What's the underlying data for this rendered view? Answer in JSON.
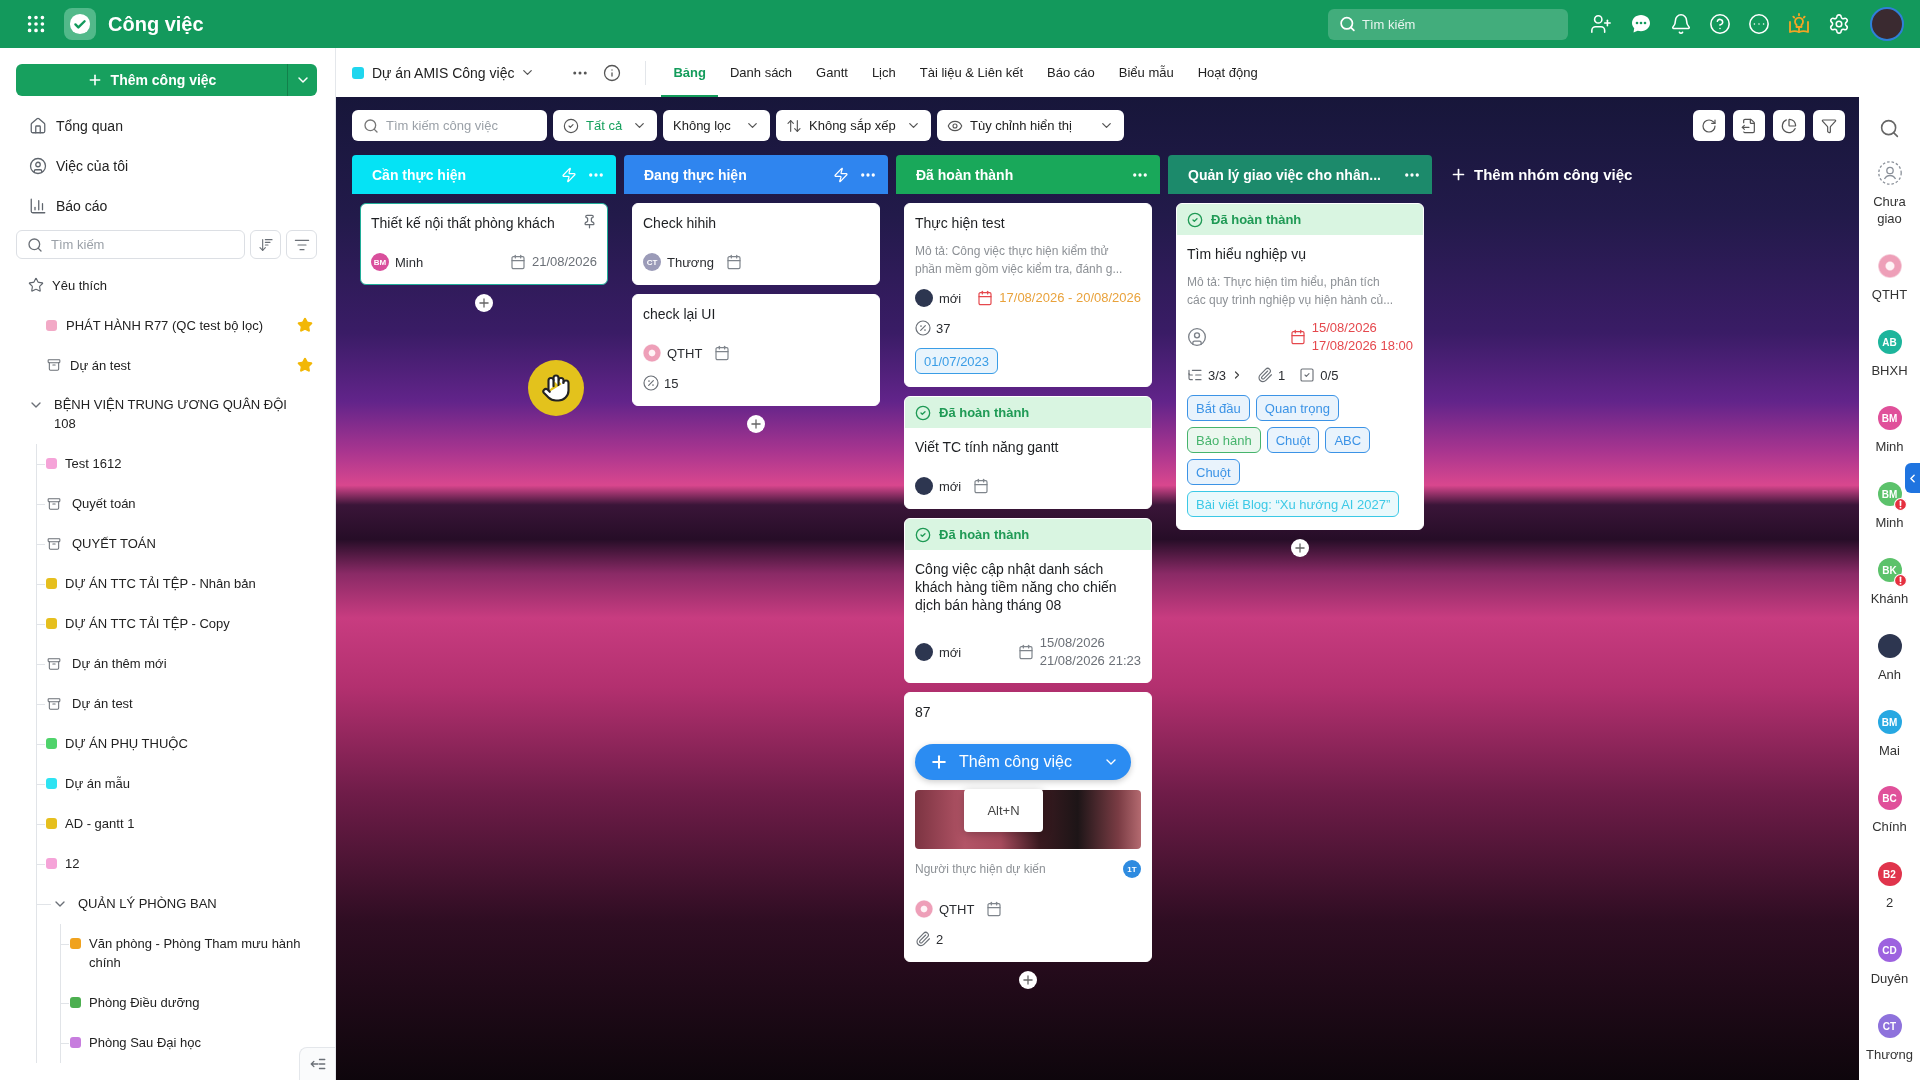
{
  "topbar": {
    "title": "Công việc",
    "search": {
      "placeholder": "Tìm kiếm"
    }
  },
  "sidebar": {
    "add_button": "Thêm công việc",
    "nav": [
      "Tổng quan",
      "Việc của tôi",
      "Báo cáo"
    ],
    "search": {
      "placeholder": "Tìm kiếm"
    },
    "favorites": {
      "label": "Yêu thích",
      "items": [
        {
          "label": "PHÁT HÀNH R77 (QC test bộ lọc)",
          "kind": "project",
          "color": "#f2a9c6",
          "starred": true
        },
        {
          "label": "Dự án test",
          "kind": "archived",
          "starred": true
        }
      ]
    },
    "tree": [
      {
        "label": "BỆNH VIỆN TRUNG ƯƠNG QUÂN ĐỘI 108",
        "kind": "group",
        "expanded": true,
        "children": [
          {
            "label": "Test 1612",
            "kind": "project",
            "color": "#f5a3d8"
          },
          {
            "label": "Quyết toán",
            "kind": "archived"
          },
          {
            "label": "QUYẾT TOÁN",
            "kind": "archived"
          },
          {
            "label": "DỰ ÁN TTC TẢI TỆP - Nhân bản",
            "kind": "project",
            "color": "#e6bf1e"
          },
          {
            "label": "DỰ ÁN TTC TẢI TỆP - Copy",
            "kind": "project",
            "color": "#e6bf1e"
          },
          {
            "label": "Dự án thêm mới",
            "kind": "archived"
          },
          {
            "label": "Dự án test",
            "kind": "archived"
          },
          {
            "label": "DỰ ÁN PHỤ THUỘC",
            "kind": "project",
            "color": "#4fd36b"
          },
          {
            "label": "Dự án mẫu",
            "kind": "project",
            "color": "#2ee3f2"
          },
          {
            "label": "AD - gantt 1",
            "kind": "project",
            "color": "#e6bf1e"
          },
          {
            "label": "12",
            "kind": "project",
            "color": "#f5a3d8"
          },
          {
            "label": "QUẢN LÝ PHÒNG BAN",
            "kind": "group",
            "expanded": true,
            "children": [
              {
                "label": "Văn phòng - Phòng Tham mưu hành chính",
                "kind": "project",
                "color": "#f0a21e"
              },
              {
                "label": "Phòng Điều dưỡng",
                "kind": "project",
                "color": "#4caf50"
              },
              {
                "label": "Phòng Sau Đại học",
                "kind": "project",
                "color": "#c77dde"
              }
            ]
          }
        ]
      }
    ]
  },
  "project": {
    "name": "Dự án AMIS Công việc",
    "tabs": [
      {
        "label": "Bảng",
        "selected": true
      },
      {
        "label": "Danh sách",
        "selected": false
      },
      {
        "label": "Gantt",
        "selected": false
      },
      {
        "label": "Lịch",
        "selected": false
      },
      {
        "label": "Tài liệu & Liên kết",
        "selected": false
      },
      {
        "label": "Báo cáo",
        "selected": false
      },
      {
        "label": "Biểu mẫu",
        "selected": false
      },
      {
        "label": "Hoạt động",
        "selected": false
      }
    ]
  },
  "toolbar": {
    "search": {
      "placeholder": "Tìm kiếm công việc"
    },
    "filters": [
      {
        "label": "Tất cả",
        "kind": "status"
      },
      {
        "label": "Không lọc",
        "kind": "filter"
      },
      {
        "label": "Không sắp xếp",
        "kind": "sort"
      },
      {
        "label": "Tùy chỉnh hiển thị",
        "kind": "view"
      }
    ]
  },
  "board": {
    "columns": [
      {
        "title": "Cần thực hiện",
        "color": "#05e3f5",
        "automation": true,
        "cards": [
          {
            "title": "Thiết kế nội thất phòng khách",
            "selected": true,
            "pinned": true,
            "assignee": {
              "kind": "initials",
              "initials": "BM",
              "name": "Minh",
              "color": "#d94f9c"
            },
            "due": {
              "kind": "normal",
              "lines": [
                "21/08/2026"
              ]
            }
          }
        ]
      },
      {
        "title": "Đang thực hiện",
        "color": "#2f85ef",
        "automation": true,
        "cards": [
          {
            "title": "Check hihih",
            "selected": false,
            "pinned": false,
            "assignee": {
              "kind": "initials",
              "initials": "CT",
              "name": "Thương",
              "color": "#9b9bb8"
            },
            "due": {
              "kind": "normal"
            }
          },
          {
            "title": "check lại UI",
            "selected": false,
            "pinned": false,
            "assignee": {
              "kind": "image",
              "name": "QTHT"
            },
            "due": {
              "kind": "normal"
            },
            "percent": "15"
          }
        ]
      },
      {
        "title": "Đã hoàn thành",
        "color": "#19a85a",
        "automation": false,
        "cards": [
          {
            "title": "Thực hiện test",
            "selected": false,
            "pinned": false,
            "description": "Mô tả: Công việc thực hiện kiểm thử phần mềm gồm việc kiểm tra, đánh g...",
            "assignee": {
              "kind": "photo",
              "name": "mới"
            },
            "due": {
              "kind": "due_soon",
              "lines": [
                "17/08/2026 - 20/08/2026"
              ]
            },
            "percent": "37",
            "tags": [
              {
                "label": "01/07/2023",
                "color": "#3a9de6"
              }
            ]
          },
          {
            "status": "Đã hoàn thành",
            "title": "Viết TC tính năng gantt",
            "selected": false,
            "pinned": false,
            "assignee": {
              "kind": "photo",
              "name": "mới"
            },
            "due": {
              "kind": "normal"
            }
          },
          {
            "status": "Đã hoàn thành",
            "title": "Công việc cập nhật danh sách khách hàng tiềm năng cho chiến dịch bán hàng tháng 08",
            "selected": false,
            "pinned": false,
            "assignee": {
              "kind": "photo",
              "name": "mới"
            },
            "due": {
              "kind": "normal",
              "lines": [
                "15/08/2026",
                "21/08/2026 21:23"
              ]
            }
          },
          {
            "title": "87",
            "selected": false,
            "pinned": false,
            "quick_add": {
              "label": "Thêm công việc",
              "shortcut": "Alt+N"
            },
            "cover": true,
            "planned": {
              "label": "Người thực hiện dự kiến",
              "initials": "1T"
            },
            "assignee": {
              "kind": "image",
              "name": "QTHT"
            },
            "due": {
              "kind": "normal"
            },
            "stats": [
              {
                "kind": "attachments",
                "text": "2"
              }
            ]
          }
        ]
      },
      {
        "title": "Quản lý giao việc cho nhân...",
        "color": "#1c8a6b",
        "automation": false,
        "cards": [
          {
            "status": "Đã hoàn thành",
            "title": "Tìm hiểu nghiệp vụ",
            "selected": false,
            "pinned": false,
            "description": "Mô tả: Thực hiện tìm hiểu, phân tích các quy trình nghiệp vụ hiện hành củ...",
            "assignee": {
              "kind": "none"
            },
            "due": {
              "kind": "overdue",
              "lines": [
                "15/08/2026",
                "17/08/2026 18:00"
              ]
            },
            "stats": [
              {
                "kind": "subtasks",
                "text": "3/3"
              },
              {
                "kind": "attachments",
                "text": "1"
              },
              {
                "kind": "checklist",
                "text": "0/5"
              }
            ],
            "tags": [
              {
                "label": "Bắt đầu",
                "color": "#3b93e6"
              },
              {
                "label": "Quan trọng",
                "color": "#3b93e6"
              },
              {
                "label": "Bảo hành",
                "color": "#46b46c"
              },
              {
                "label": "Chuột",
                "color": "#3b93e6"
              },
              {
                "label": "ABC",
                "color": "#3b93e6"
              },
              {
                "label": "Chuột",
                "color": "#3b93e6"
              },
              {
                "label": "Bài viết Blog: “Xu hướng AI 2027”",
                "color": "#3cc9e6"
              }
            ]
          }
        ]
      }
    ],
    "add_group": "Thêm nhóm công việc"
  },
  "rail": {
    "people": [
      {
        "name": "Chưa giao",
        "kind": "unassigned",
        "alert": false
      },
      {
        "name": "QTHT",
        "kind": "image",
        "alert": false
      },
      {
        "name": "BHXH",
        "kind": "initials",
        "initials": "AB",
        "color": "#1db59c",
        "alert": false
      },
      {
        "name": "Minh",
        "kind": "initials",
        "initials": "BM",
        "color": "#e0509a",
        "alert": false
      },
      {
        "name": "Minh",
        "kind": "initials",
        "initials": "BM",
        "color": "#5cc26b",
        "alert": true
      },
      {
        "name": "Khánh",
        "kind": "initials",
        "initials": "BK",
        "color": "#5cc26b",
        "alert": true
      },
      {
        "name": "Anh",
        "kind": "photo",
        "alert": false
      },
      {
        "name": "Mai",
        "kind": "initials",
        "initials": "BM",
        "color": "#27a8e2",
        "alert": false
      },
      {
        "name": "Chính",
        "kind": "initials",
        "initials": "BC",
        "color": "#e0509a",
        "alert": false
      },
      {
        "name": "2",
        "kind": "initials",
        "initials": "B2",
        "color": "#e0344c",
        "alert": false
      },
      {
        "name": "Duyên",
        "kind": "initials",
        "initials": "CD",
        "color": "#9d62df",
        "alert": false
      },
      {
        "name": "Thương",
        "kind": "initials",
        "initials": "CT",
        "color": "#8e72dc",
        "alert": false
      }
    ]
  }
}
